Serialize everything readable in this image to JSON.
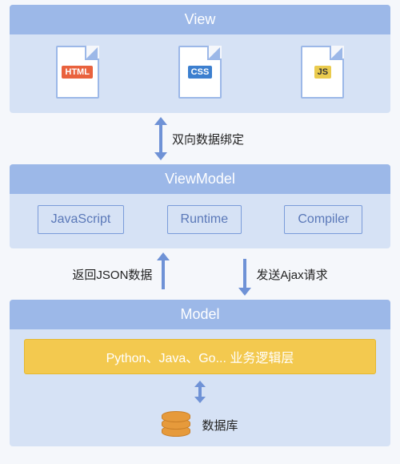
{
  "view": {
    "title": "View",
    "files": {
      "html": "HTML",
      "css": "CSS",
      "js": "JS"
    }
  },
  "connector1": {
    "label": "双向数据绑定"
  },
  "viewmodel": {
    "title": "ViewModel",
    "items": [
      "JavaScript",
      "Runtime",
      "Compiler"
    ]
  },
  "connector2": {
    "left_label": "返回JSON数据",
    "right_label": "发送Ajax请求"
  },
  "model": {
    "title": "Model",
    "business_layer": "Python、Java、Go... 业务逻辑层",
    "database_label": "数据库"
  }
}
